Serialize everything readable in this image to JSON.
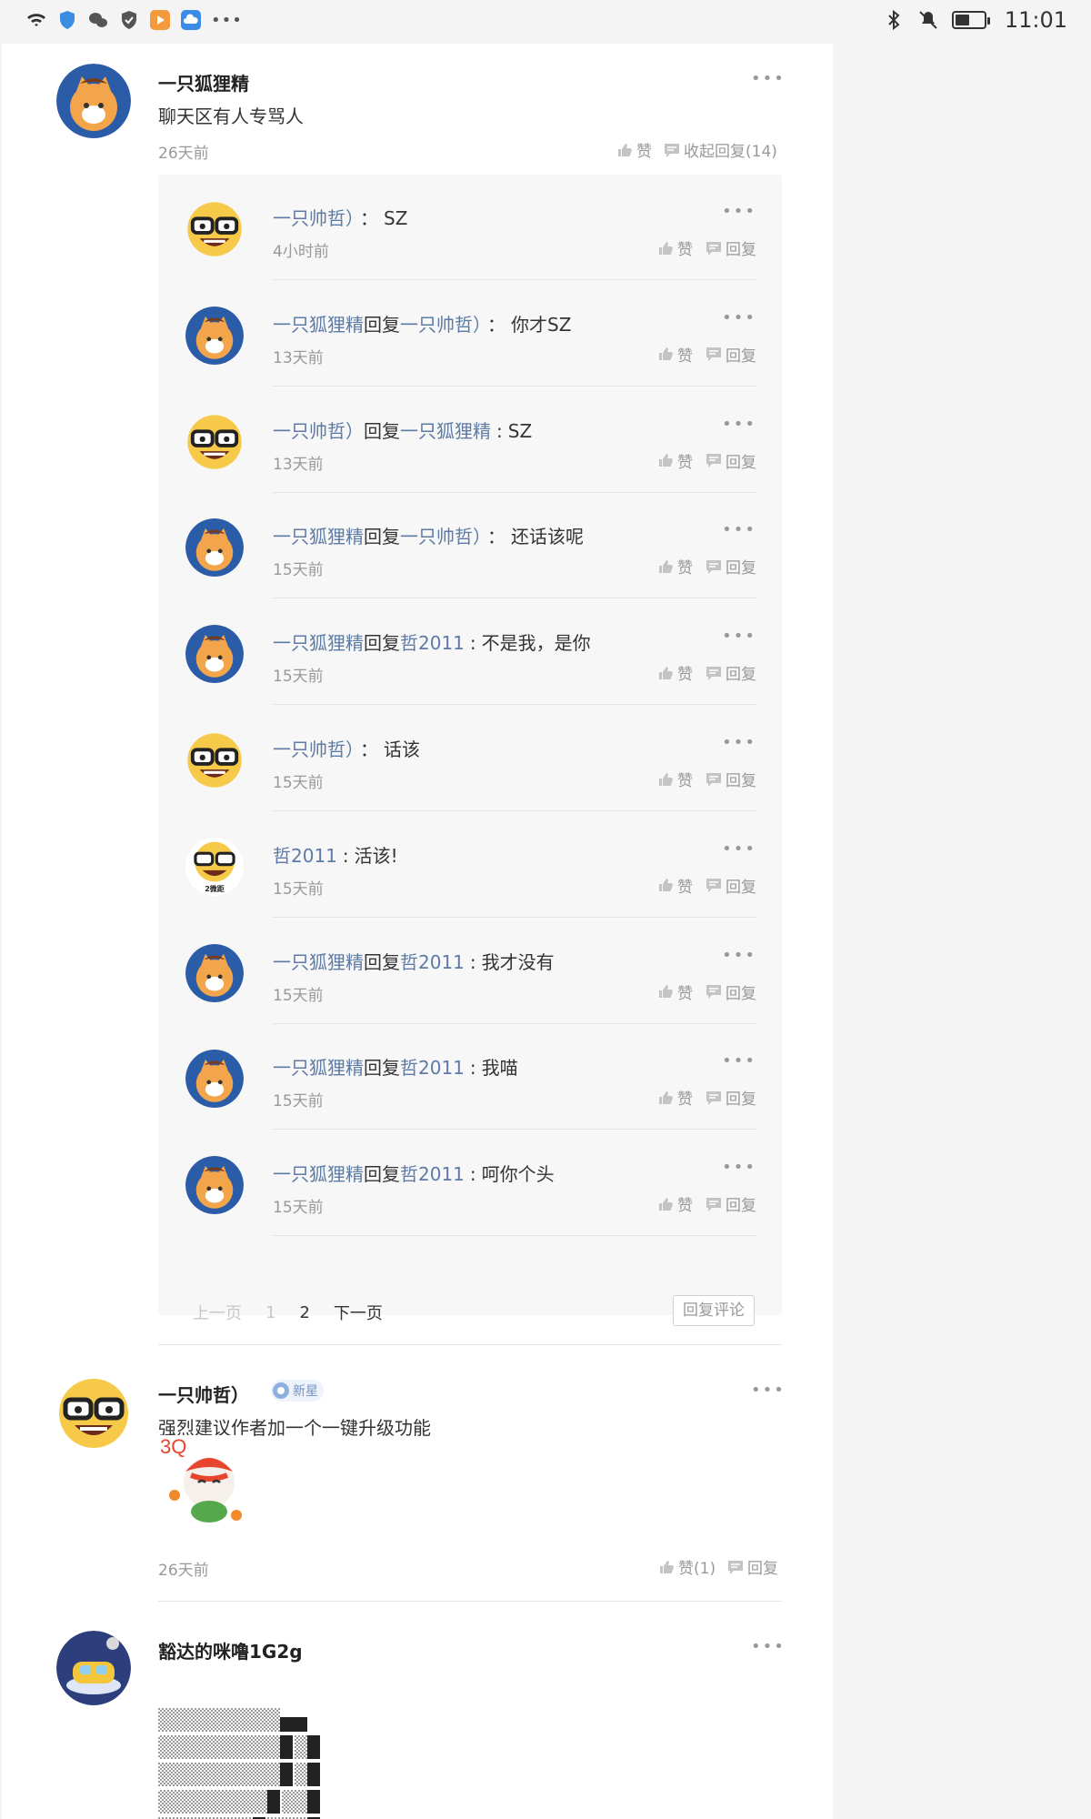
{
  "status_bar": {
    "time": "11:01"
  },
  "comments": [
    {
      "user": "一只狐狸精",
      "text": "聊天区有人专骂人",
      "time": "26天前",
      "like_label": "赞",
      "collapse_label": "收起回复(14)"
    },
    {
      "user": "一只帅哲）",
      "badge": "新星",
      "text": "强烈建议作者加一个一键升级功能",
      "sticker_text": "3Q",
      "time": "26天前",
      "like_label": "赞(1)",
      "reply_label": "回复"
    },
    {
      "user": "豁达的咪噜1G2g"
    }
  ],
  "replies": [
    {
      "from": "一只帅哲）",
      "to": "",
      "sep": "：",
      "text": "SZ",
      "time": "4小时前",
      "avatar": "nerd"
    },
    {
      "from": "一只狐狸精",
      "to": "一只帅哲）",
      "sep": "：",
      "text": "你才SZ",
      "time": "13天前",
      "avatar": "fox"
    },
    {
      "from": "一只帅哲）",
      "to": "一只狐狸精",
      "sep": ":",
      "text": "SZ",
      "time": "13天前",
      "avatar": "nerd"
    },
    {
      "from": "一只狐狸精",
      "to": "一只帅哲）",
      "sep": "：",
      "text": "还话该呢",
      "time": "15天前",
      "avatar": "fox"
    },
    {
      "from": "一只狐狸精",
      "to": "哲2011",
      "sep": ":",
      "text": "不是我，是你",
      "time": "15天前",
      "avatar": "fox"
    },
    {
      "from": "一只帅哲）",
      "to": "",
      "sep": "：",
      "text": "话该",
      "time": "15天前",
      "avatar": "nerd"
    },
    {
      "from": "哲2011",
      "to": "",
      "sep": ":",
      "text": "活该!",
      "time": "15天前",
      "avatar": "nerd2"
    },
    {
      "from": "一只狐狸精",
      "to": "哲2011",
      "sep": ":",
      "text": "我才没有",
      "time": "15天前",
      "avatar": "fox"
    },
    {
      "from": "一只狐狸精",
      "to": "哲2011",
      "sep": ":",
      "text": "我喵",
      "time": "15天前",
      "avatar": "fox"
    },
    {
      "from": "一只狐狸精",
      "to": "哲2011",
      "sep": ":",
      "text": "呵你个头",
      "time": "15天前",
      "avatar": "fox"
    }
  ],
  "reply_labels": {
    "reply_word": "回复",
    "like": "赞",
    "reply": "回复"
  },
  "nerd2_caption": "2微距",
  "pager": {
    "prev": "上一页",
    "page1": "1",
    "page2": "2",
    "next": "下一页",
    "reply_comment": "回复评论"
  },
  "colors": {
    "link": "#5d7ba6",
    "muted": "#999999",
    "panel": "#ffffff",
    "bg": "#f4f4f4"
  },
  "icons": [
    "wifi-icon",
    "shield-icon",
    "wechat-icon",
    "vpn-icon",
    "video-app-icon",
    "cloud-icon",
    "more-icon",
    "bluetooth-icon",
    "mute-icon",
    "battery-icon",
    "thumb-up-icon",
    "comment-icon"
  ]
}
